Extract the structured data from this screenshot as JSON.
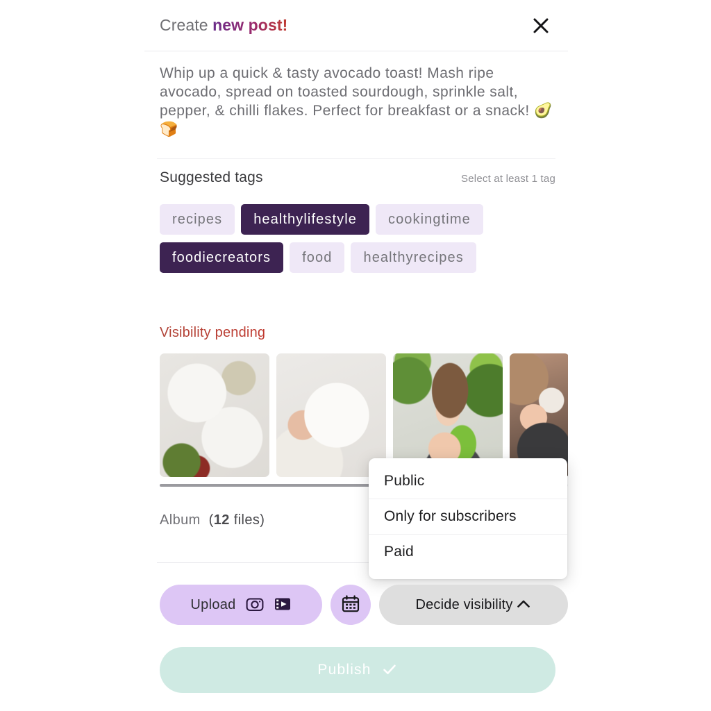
{
  "header": {
    "title_plain": "Create ",
    "title_accent": "new post!",
    "close_icon": "close-icon"
  },
  "description": {
    "text": "Whip up a quick & tasty avocado toast! Mash ripe avocado, spread on toasted sourdough, sprinkle salt, pepper, & chilli flakes. Perfect for breakfast or a snack! ",
    "emoji": "🥑🍞"
  },
  "tags_section": {
    "label": "Suggested tags",
    "hint": "Select at least 1 tag",
    "tags": [
      {
        "label": "recipes",
        "selected": false
      },
      {
        "label": "healthylifestyle",
        "selected": true
      },
      {
        "label": "cookingtime",
        "selected": false
      },
      {
        "label": "foodiecreators",
        "selected": true
      },
      {
        "label": "food",
        "selected": false
      },
      {
        "label": "healthyrecipes",
        "selected": false
      }
    ]
  },
  "visibility_status": "Visibility pending",
  "media": {
    "scroll_position_percent": 55,
    "album_label": "Album",
    "album_count": "(12 files)",
    "album_count_number": "12",
    "album_count_unit": " files)",
    "thumbnails": [
      {
        "name": "thumb-salad-bowls"
      },
      {
        "name": "thumb-granola-bowl"
      },
      {
        "name": "thumb-woman-greens"
      },
      {
        "name": "thumb-cooking-pan"
      }
    ]
  },
  "visibility_dropdown": {
    "open": true,
    "options": [
      "Public",
      "Only for subscribers",
      "Paid"
    ]
  },
  "actions": {
    "upload_label": "Upload",
    "upload_icons": [
      "camera-icon",
      "video-icon"
    ],
    "calendar_icon": "calendar-icon",
    "visibility_label": "Decide visibility",
    "visibility_chevron": "chevron-up-icon"
  },
  "publish": {
    "label": "Publish",
    "icon": "check-icon",
    "disabled": true
  },
  "colors": {
    "tag_selected_bg": "#3d2352",
    "tag_unselected_bg": "#efe8f7",
    "upload_bg": "#ddc6f5",
    "visibility_bg": "#dedede",
    "publish_bg": "#cfeae3",
    "status_accent": "#c0392f"
  }
}
